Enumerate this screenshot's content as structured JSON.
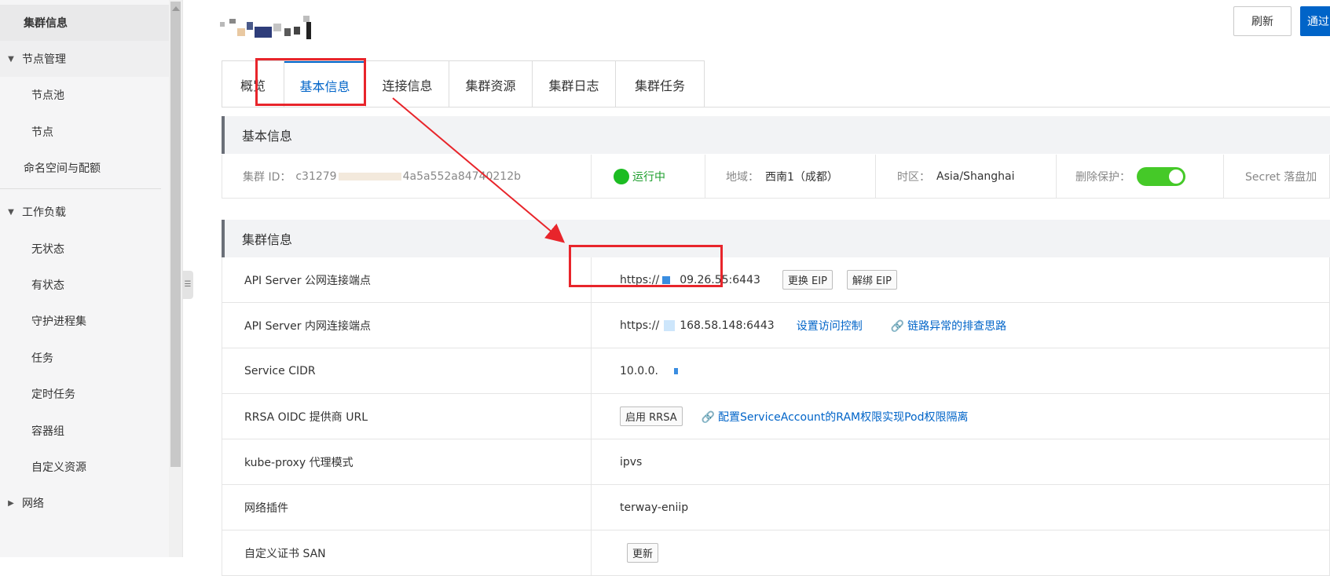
{
  "sidebar": {
    "items": [
      {
        "label": "集群信息",
        "type": "top",
        "active": true
      },
      {
        "label": "节点管理",
        "type": "group"
      },
      {
        "label": "节点池",
        "type": "child"
      },
      {
        "label": "节点",
        "type": "child"
      },
      {
        "label": "命名空间与配额",
        "type": "top"
      },
      {
        "label": "工作负载",
        "type": "group"
      },
      {
        "label": "无状态",
        "type": "child"
      },
      {
        "label": "有状态",
        "type": "child"
      },
      {
        "label": "守护进程集",
        "type": "child"
      },
      {
        "label": "任务",
        "type": "child"
      },
      {
        "label": "定时任务",
        "type": "child"
      },
      {
        "label": "容器组",
        "type": "child"
      },
      {
        "label": "自定义资源",
        "type": "child"
      },
      {
        "label": "网络",
        "type": "group-collapsed"
      }
    ]
  },
  "header": {
    "refresh_label": "刷新",
    "primary_label": "通过"
  },
  "tabs": [
    {
      "label": "概览"
    },
    {
      "label": "基本信息",
      "active": true
    },
    {
      "label": "连接信息"
    },
    {
      "label": "集群资源"
    },
    {
      "label": "集群日志"
    },
    {
      "label": "集群任务"
    }
  ],
  "basic_info": {
    "title": "基本信息",
    "cluster_id_label": "集群 ID：",
    "cluster_id_value_start": "c31279",
    "cluster_id_value_end": "4a5a552a84740212b",
    "status": "运行中",
    "region_label": "地域：",
    "region_value": "西南1（成都）",
    "timezone_label": "时区：",
    "timezone_value": "Asia/Shanghai",
    "delete_protect_label": "删除保护：",
    "delete_protect_on": true,
    "secret_label": "Secret 落盘加"
  },
  "cluster_info": {
    "title": "集群信息",
    "rows": [
      {
        "label": "API Server 公网连接端点",
        "value_start": "https://",
        "value_end": "09.26.55:6443",
        "btn1": "更换 EIP",
        "btn2": "解绑 EIP"
      },
      {
        "label": "API Server 内网连接端点",
        "value_start": "https://",
        "value_end": "168.58.148:6443",
        "link1": "设置访问控制",
        "link2": "链路异常的排查思路"
      },
      {
        "label": "Service CIDR",
        "value": "10.0.0."
      },
      {
        "label": "RRSA OIDC 提供商 URL",
        "btn1": "启用 RRSA",
        "link1": "配置ServiceAccount的RAM权限实现Pod权限隔离"
      },
      {
        "label": "kube-proxy 代理模式",
        "value": "ipvs"
      },
      {
        "label": "网络插件",
        "value": "terway-eniip"
      },
      {
        "label": "自定义证书 SAN",
        "btn1": "更新"
      }
    ]
  },
  "colors": {
    "primary": "#0064c8",
    "status_green": "#1cbc22",
    "toggle_green": "#45c928",
    "annotation_red": "#e8252b"
  }
}
